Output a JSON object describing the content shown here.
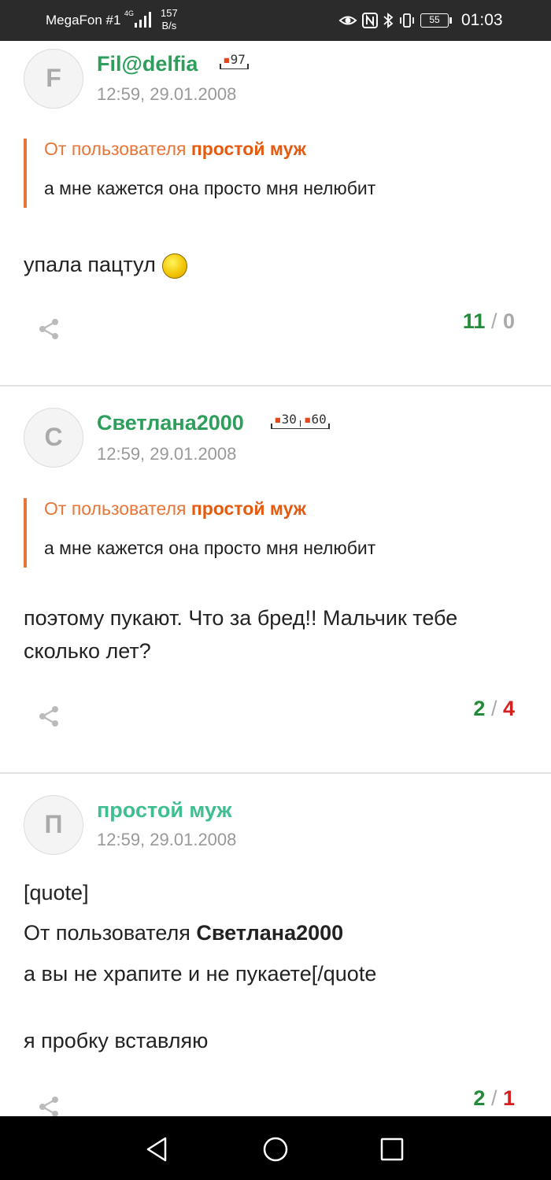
{
  "status_bar": {
    "carrier": "MegaFon #1",
    "network": "4G",
    "speed_value": "157",
    "speed_unit": "B/s",
    "battery": "55",
    "time": "01:03"
  },
  "comments": [
    {
      "avatar_letter": "F",
      "author": "Fil@delfia",
      "badges": [
        "97"
      ],
      "date": "12:59, 29.01.2008",
      "quote": {
        "prefix": "От пользователя ",
        "user": "простой муж",
        "text": "а мне кажется она просто мня нелюбит"
      },
      "text": "упала пацтул",
      "votes_up": "11",
      "votes_down": "0"
    },
    {
      "avatar_letter": "С",
      "author": "Светлана2000",
      "badges": [
        "30",
        "60"
      ],
      "date": "12:59, 29.01.2008",
      "quote": {
        "prefix": "От пользователя ",
        "user": "простой муж",
        "text": "а мне кажется она просто мня нелюбит"
      },
      "text": "поэтому пукают. Что за бред!! Мальчик тебе сколько лет?",
      "votes_up": "2",
      "votes_down": "4"
    },
    {
      "avatar_letter": "П",
      "author": "простой муж",
      "date": "12:59, 29.01.2008",
      "text_line1": "[quote]",
      "text_line2_prefix": "От пользователя ",
      "text_line2_user": "Светлана2000",
      "text_line3": "а вы не храпите и не пукаете[/quote",
      "text_line4": "я пробку вставляю",
      "votes_up": "2",
      "votes_down": "1"
    }
  ],
  "vote_separator": "/",
  "colors": {
    "author_green": "#2e9e5c",
    "quote_orange": "#e87537",
    "vote_up": "#238a3a",
    "vote_down": "#d42020"
  },
  "icons": [
    "share-icon",
    "back-icon",
    "home-icon",
    "recents-icon"
  ]
}
